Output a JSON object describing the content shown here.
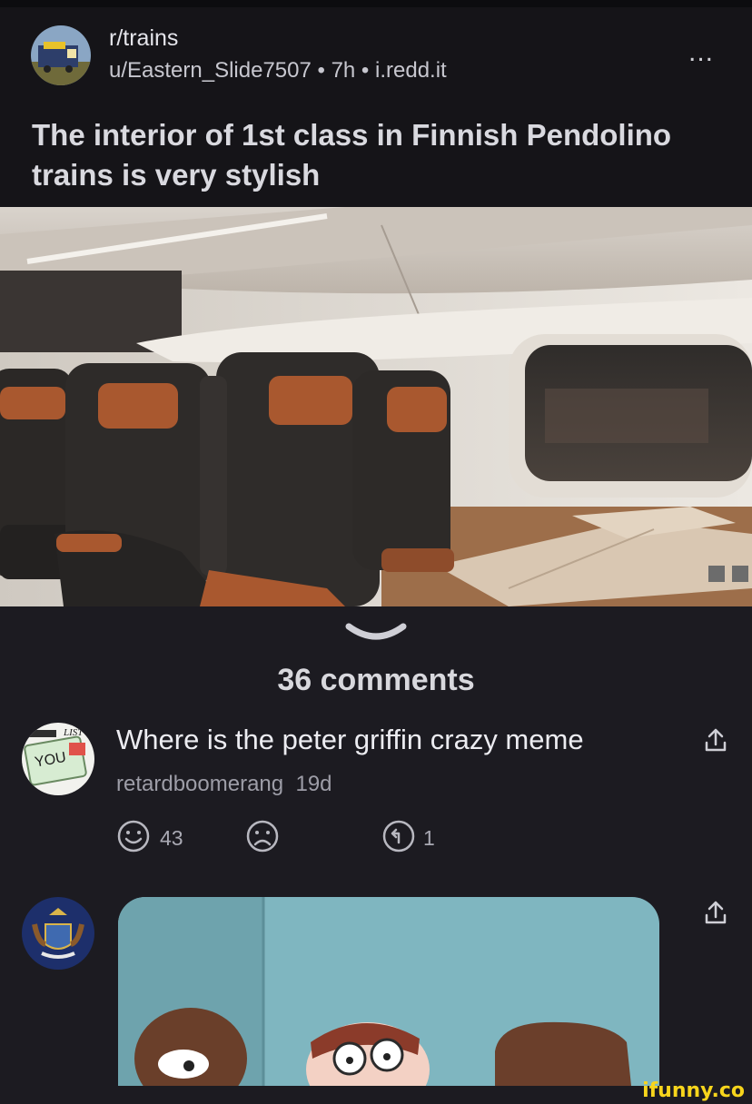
{
  "post": {
    "subreddit": "r/trains",
    "author_meta": "u/Eastern_Slide7507 • 7h • i.redd.it",
    "more_label": "...",
    "title": "The interior of 1st class in Finnish Pendolino trains is very stylish"
  },
  "comments_header": "36 comments",
  "comment1": {
    "text": "Where is the peter griffin crazy meme",
    "username": "retardboomerang",
    "age": "19d",
    "upvotes": "43",
    "replies": "1",
    "avatar_sticker_text": "YOU",
    "avatar_sticker_list": "LIST"
  },
  "watermark": "ifunny.co",
  "colors": {
    "background": "#1c1b21",
    "header_bg": "#151418",
    "seat_leather": "#a9582f",
    "watermark": "#f7d51c"
  }
}
